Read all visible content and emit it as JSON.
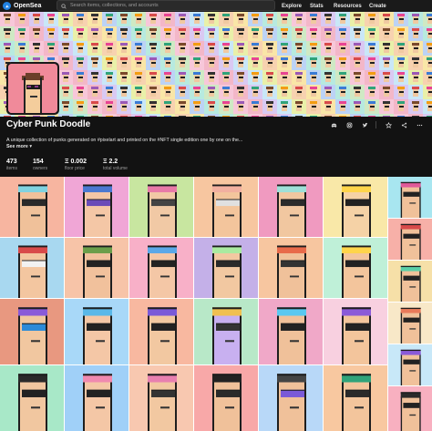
{
  "nav": {
    "brand": "OpenSea",
    "search_placeholder": "Search items, collections, and accounts",
    "links": [
      "Explore",
      "Stats",
      "Resources",
      "Create"
    ]
  },
  "collection": {
    "name": "Cyber Punk Doodle",
    "description": "A unique collection of punks generated on #pixelart and printed on the #NFT single edition one by one on the...",
    "see_more": "See more",
    "stats": [
      {
        "value": "473",
        "label": "items"
      },
      {
        "value": "154",
        "label": "owners"
      },
      {
        "value": "0.002",
        "label": "floor price"
      },
      {
        "value": "2.2",
        "label": "total volume"
      }
    ]
  },
  "icons": {
    "brand": "opensea-logo-icon",
    "search": "search-icon",
    "discord": "discord-icon",
    "instagram": "instagram-icon",
    "twitter": "twitter-icon",
    "star": "star-icon",
    "share": "share-icon",
    "more": "more-icon",
    "eth": "eth-icon"
  },
  "colors": {
    "accent": "#2081e2",
    "background": "#121212"
  }
}
